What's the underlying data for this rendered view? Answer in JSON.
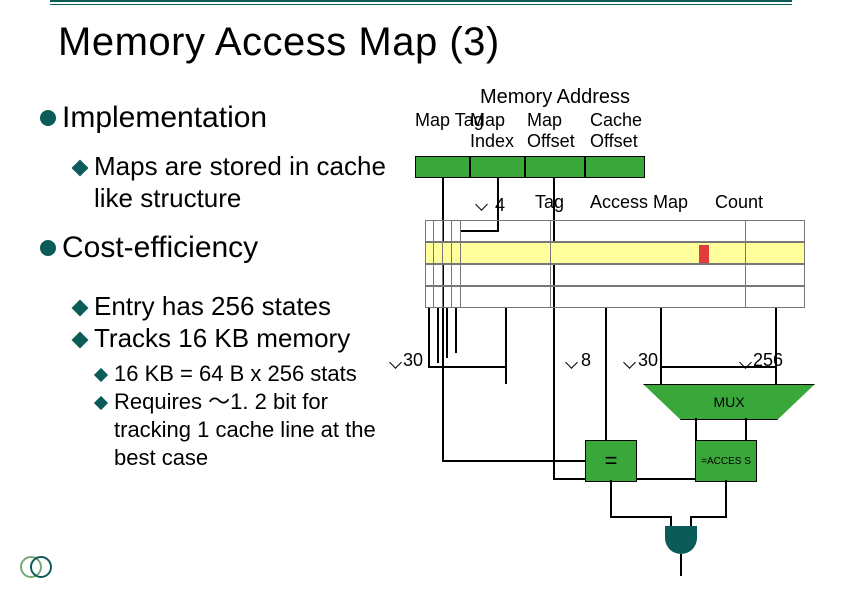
{
  "title": "Memory Access Map (3)",
  "bullets": {
    "impl": "Implementation",
    "impl_sub1": "Maps are stored in cache like structure",
    "cost": "Cost-efficiency",
    "cost_sub1": "Entry has 256 states",
    "cost_sub2": "Tracks 16 KB memory",
    "cost_sub2_sub1": "16 KB = 64 B x 256 stats",
    "cost_sub2_sub2": "Requires ～1. 2 bit for tracking 1 cache line at the best case"
  },
  "diagram": {
    "mem_addr_title": "Memory Address",
    "hdr_map_tag": "Map Tag",
    "hdr_map_index": "Map Index",
    "hdr_map_offset": "Map Offset",
    "hdr_cache_offset": "Cache Offset",
    "ways": "4",
    "tag_col": "Tag",
    "accmap_col": "Access Map",
    "count_col": "Count",
    "w30": "30",
    "w8": "8",
    "w30b": "30",
    "w256": "256",
    "mux": "MUX",
    "eq": "=",
    "access": "=ACCES S"
  }
}
